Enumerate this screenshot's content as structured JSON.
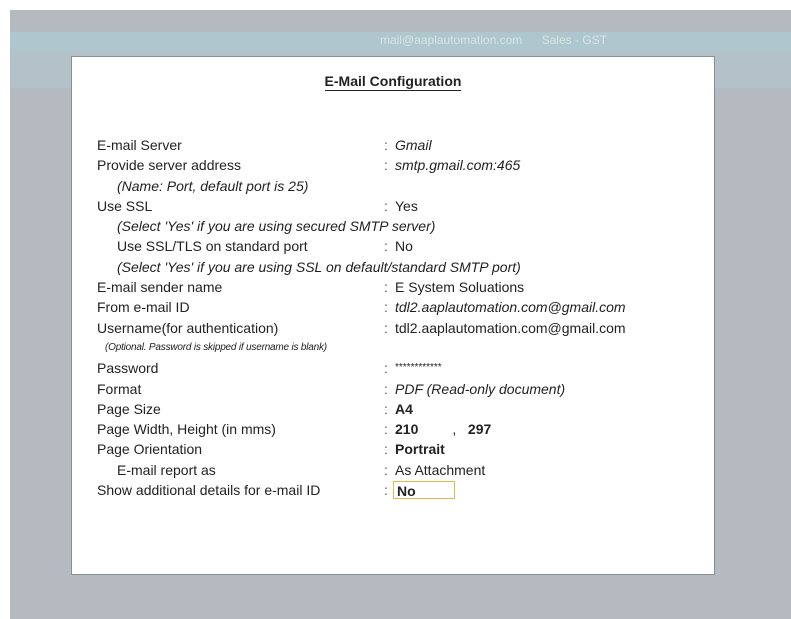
{
  "header": {
    "email": "mail@aaplautomation.com",
    "module": "Sales - GST"
  },
  "dialog": {
    "title": "E-Mail Configuration",
    "rows": {
      "email_server": {
        "label": "E-mail Server",
        "value": "Gmail"
      },
      "server_address": {
        "label": "Provide server address",
        "value": "smtp.gmail.com:465"
      },
      "server_address_note": "(Name: Port, default port is 25)",
      "use_ssl": {
        "label": "Use SSL",
        "value": "Yes"
      },
      "use_ssl_note": "(Select 'Yes' if you are using secured SMTP server)",
      "ssl_tls": {
        "label": "Use SSL/TLS on standard port",
        "value": "No"
      },
      "ssl_tls_note": "(Select 'Yes' if you are using SSL on default/standard SMTP port)",
      "sender_name": {
        "label": "E-mail sender name",
        "value": "E System Soluations"
      },
      "from_email": {
        "label": "From e-mail ID",
        "value": "tdl2.aaplautomation.com@gmail.com"
      },
      "username": {
        "label": "Username(for authentication)",
        "value": "tdl2.aaplautomation.com@gmail.com"
      },
      "username_note": "(Optional. Password is skipped if username is blank)",
      "password": {
        "label": "Password",
        "value": "************"
      },
      "format": {
        "label": "Format",
        "value": "PDF (Read-only document)"
      },
      "page_size": {
        "label": "Page Size",
        "value": "A4"
      },
      "page_dims": {
        "label": "Page Width, Height (in mms)",
        "width": "210",
        "sep": ",",
        "height": "297"
      },
      "orientation": {
        "label": "Page Orientation",
        "value": "Portrait"
      },
      "report_as": {
        "label": "E-mail report as",
        "value": "As Attachment"
      },
      "additional": {
        "label": "Show additional details for e-mail ID",
        "value": "No"
      }
    }
  }
}
